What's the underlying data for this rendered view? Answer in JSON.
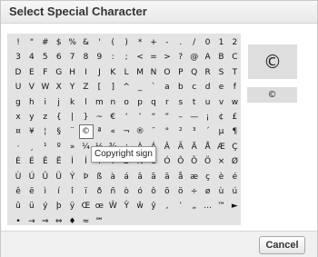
{
  "dialog": {
    "title": "Select Special Character",
    "cancel_label": "Cancel"
  },
  "preview": {
    "large": "©",
    "small": "©"
  },
  "tooltip": "Copyright sign",
  "selected_character": "©",
  "characters": [
    [
      "!",
      "\"",
      "#",
      "$",
      "%",
      "&",
      "'",
      "(",
      ")",
      "*",
      "+",
      "-",
      ".",
      "/",
      "0",
      "1",
      "2"
    ],
    [
      "3",
      "4",
      "5",
      "6",
      "7",
      "8",
      "9",
      ":",
      ";",
      "<",
      "=",
      ">",
      "?",
      "@",
      "A",
      "B",
      "C"
    ],
    [
      "D",
      "E",
      "F",
      "G",
      "H",
      "I",
      "J",
      "K",
      "L",
      "M",
      "N",
      "O",
      "P",
      "Q",
      "R",
      "S",
      "T"
    ],
    [
      "U",
      "V",
      "W",
      "X",
      "Y",
      "Z",
      "[",
      "]",
      "^",
      "_",
      "`",
      "a",
      "b",
      "c",
      "d",
      "e",
      "f"
    ],
    [
      "g",
      "h",
      "i",
      "j",
      "k",
      "l",
      "m",
      "n",
      "o",
      "p",
      "q",
      "r",
      "s",
      "t",
      "u",
      "v",
      "w"
    ],
    [
      "x",
      "y",
      "z",
      "{",
      "|",
      "}",
      "~",
      "€",
      "‘",
      "’",
      "“",
      "”",
      "–",
      "—",
      "¡",
      "¢",
      "£"
    ],
    [
      "¤",
      "¥",
      "¦",
      "§",
      "¨",
      "©",
      "ª",
      "«",
      "¬",
      "®",
      "¯",
      "°",
      "²",
      "³",
      "´",
      "µ",
      "¶"
    ],
    [
      "·",
      "¸",
      "¹",
      "º",
      "»",
      "¼",
      "½",
      "¾",
      "¿",
      "À",
      "Á",
      "Â",
      "Ã",
      "Ä",
      "Å",
      "Æ",
      "Ç"
    ],
    [
      "È",
      "É",
      "Ê",
      "Ë",
      "Ì",
      "Í",
      "Î",
      "Ï",
      "Ð",
      "Ñ",
      "Ò",
      "Ó",
      "Ô",
      "Õ",
      "Ö",
      "×",
      "Ø"
    ],
    [
      "Ù",
      "Ú",
      "Û",
      "Ü",
      "Ý",
      "Þ",
      "ß",
      "à",
      "á",
      "â",
      "ã",
      "ä",
      "å",
      "æ",
      "ç",
      "è",
      "é"
    ],
    [
      "ê",
      "ë",
      "ì",
      "í",
      "î",
      "ï",
      "ð",
      "ñ",
      "ò",
      "ó",
      "ô",
      "õ",
      "ö",
      "÷",
      "ø",
      "ù",
      "ú"
    ],
    [
      "û",
      "ü",
      "ý",
      "þ",
      "ÿ",
      "Œ",
      "œ",
      "Ŵ",
      "Ŷ",
      "ŵ",
      "ŷ",
      "‚",
      "‛",
      "„",
      "…",
      "™",
      "►"
    ],
    [
      "•",
      "→",
      "⇒",
      "⇔",
      "♦",
      "≈",
      "℠"
    ]
  ]
}
